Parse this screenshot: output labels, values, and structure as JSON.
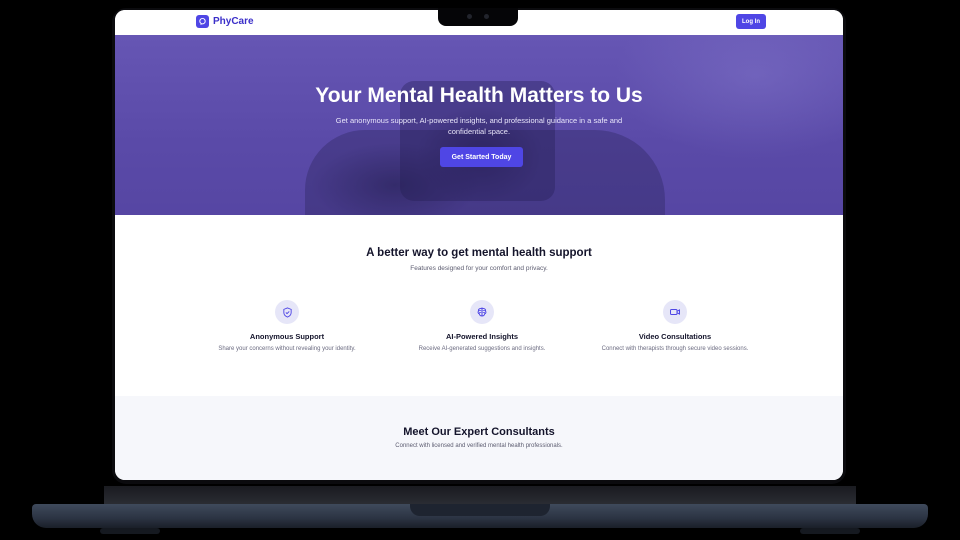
{
  "brand": {
    "name": "PhyCare"
  },
  "nav": {
    "login_label": "Log In"
  },
  "hero": {
    "title": "Your Mental Health Matters to Us",
    "subtitle": "Get anonymous support, AI-powered insights, and professional guidance in a safe and confidential space.",
    "cta_label": "Get Started Today"
  },
  "features": {
    "title": "A better way to get mental health support",
    "subtitle": "Features designed for your comfort and privacy.",
    "items": [
      {
        "icon": "shield-icon",
        "title": "Anonymous Support",
        "description": "Share your concerns without revealing your identity."
      },
      {
        "icon": "brain-icon",
        "title": "AI-Powered Insights",
        "description": "Receive AI-generated suggestions and insights."
      },
      {
        "icon": "video-camera-icon",
        "title": "Video Consultations",
        "description": "Connect with therapists through secure video sessions."
      }
    ]
  },
  "consultants": {
    "title": "Meet Our Expert Consultants",
    "subtitle": "Connect with licensed and verified mental health professionals."
  },
  "colors": {
    "accent": "#4f46e5",
    "hero_overlay": "#5a4aa8",
    "section_alt_bg": "#f6f7fb"
  }
}
